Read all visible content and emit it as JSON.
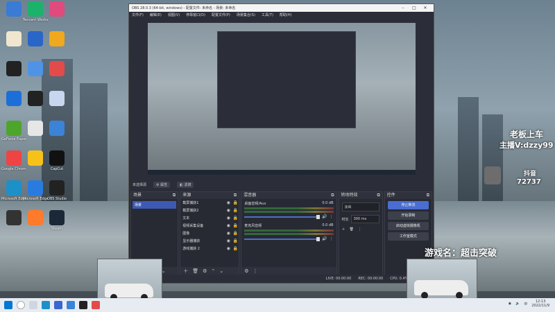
{
  "desktop_icons": [
    {
      "label": "",
      "color": "#3a7bd5"
    },
    {
      "label": "Tencent Workshop",
      "color": "#1bb36b"
    },
    {
      "label": "",
      "color": "#e04a7d"
    },
    {
      "label": "",
      "color": "#f0e6cf"
    },
    {
      "label": "",
      "color": "#2a65c8"
    },
    {
      "label": "",
      "color": "#f0a81e"
    },
    {
      "label": "",
      "color": "#222222"
    },
    {
      "label": "",
      "color": "#4f93e6"
    },
    {
      "label": "",
      "color": "#e34a4a"
    },
    {
      "label": "",
      "color": "#1c6fd9"
    },
    {
      "label": "",
      "color": "#222222"
    },
    {
      "label": "",
      "color": "#c8d7ef"
    },
    {
      "label": "GeForce Experience",
      "color": "#4ea52c"
    },
    {
      "label": "",
      "color": "#e6e6e6"
    },
    {
      "label": "",
      "color": "#3b83d6"
    },
    {
      "label": "Google Chrome",
      "color": "#e44"
    },
    {
      "label": "",
      "color": "#f6c21a"
    },
    {
      "label": "CapCut",
      "color": "#111"
    },
    {
      "label": "Microsoft Edge",
      "color": "#1e90c8"
    },
    {
      "label": "Microsoft Edge",
      "color": "#2a7be0"
    },
    {
      "label": "OBS Studio",
      "color": "#222"
    },
    {
      "label": "",
      "color": "#333"
    },
    {
      "label": "",
      "color": "#ff7a2a"
    },
    {
      "label": "Steam",
      "color": "#1b2838"
    }
  ],
  "obs": {
    "title": "OBS 28.0.3 (64-bit, windows) - 配置文件: 未命名 - 场景: 未命名",
    "menu": [
      "文件(F)",
      "编辑(E)",
      "视图(V)",
      "停靠窗口(D)",
      "配置文件(P)",
      "场景集合(S)",
      "工具(T)",
      "帮助(H)"
    ],
    "sourcebar": {
      "label": "未选择源",
      "properties": "属性",
      "filters": "滤镜"
    },
    "docks": {
      "scenes": {
        "title": "场景",
        "items": [
          "场景"
        ]
      },
      "sources": {
        "title": "来源",
        "items": [
          "截屏捕获1",
          "截屏捕获2",
          "文本",
          "视频采集设备",
          "图像",
          "显示器捕获",
          "游戏捕获 2"
        ]
      },
      "mixer": {
        "title": "混音器",
        "channels": [
          {
            "name": "桌面音频/Aux",
            "db": "0.0 dB"
          },
          {
            "name": "麦克风音频",
            "db": "0.0 dB"
          }
        ]
      },
      "transitions": {
        "title": "转场特效",
        "type": "淡出",
        "duration_label": "时长",
        "duration_value": "300 ms"
      },
      "controls": {
        "title": "控件",
        "buttons": [
          "停止推流",
          "开始录制",
          "启动虚拟摄像机",
          "工作室模式"
        ]
      }
    },
    "status": {
      "live": "LIVE: 00:00:00",
      "rec": "REC: 00:00:00",
      "cpu": "CPU: 0.4%, 60.00 fps"
    }
  },
  "overlays": {
    "top_right_line1": "老板上车",
    "top_right_line2": "主播V:dzzy99",
    "douyin_label": "抖音",
    "douyin_number": "72737",
    "game_name": "游戏名：超击突破"
  },
  "taskbar": {
    "time": "12:13",
    "date": "2022/11/9",
    "lang": "中"
  }
}
